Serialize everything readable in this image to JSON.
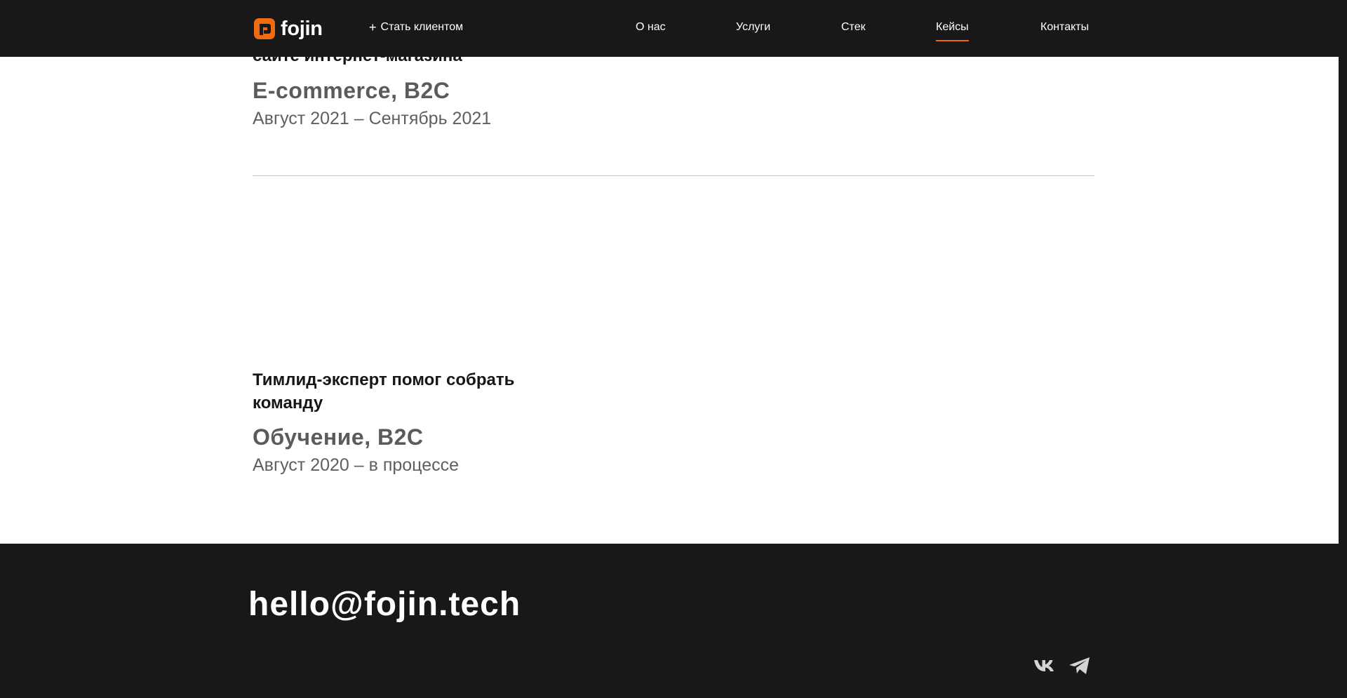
{
  "header": {
    "logo_text": "fojin",
    "become_client": "Стать клиентом",
    "nav": [
      {
        "label": "О нас",
        "active": false
      },
      {
        "label": "Услуги",
        "active": false
      },
      {
        "label": "Стек",
        "active": false
      },
      {
        "label": "Кейсы",
        "active": true
      },
      {
        "label": "Контакты",
        "active": false
      }
    ],
    "accent_color": "#f06a12"
  },
  "cases": [
    {
      "title": "сайте интернет-магазина",
      "category": "E-commerce, B2C",
      "dates": "Август 2021 – Сентябрь 2021"
    },
    {
      "title": "Тимлид-эксперт помог собрать команду",
      "category": "Обучение, B2C",
      "dates": "Август 2020 – в процессе"
    }
  ],
  "footer": {
    "email": "hello@fojin.tech",
    "socials": [
      {
        "icon": "vk-icon"
      },
      {
        "icon": "telegram-icon"
      }
    ]
  }
}
